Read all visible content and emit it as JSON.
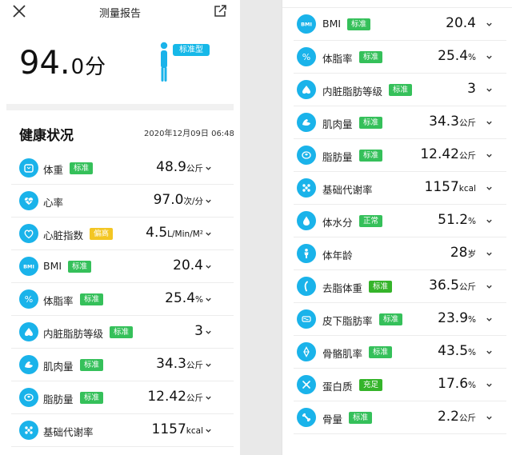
{
  "header": {
    "title": "测量报告"
  },
  "score": {
    "value": "94.",
    "value_small": "0",
    "unit": "分"
  },
  "body_type": {
    "label": "标准型"
  },
  "health": {
    "title": "健康状况",
    "datetime": "2020年12月09日 06:48"
  },
  "colors": {
    "accent": "#1ab3ea",
    "badge_standard": "#35c05a",
    "badge_high": "#f3c623",
    "badge_sufficient": "#35b42a"
  },
  "left_metrics": [
    {
      "name": "体重",
      "badge": "标准",
      "badge_color": "#35c05a",
      "value": "48.9",
      "unit": "公斤",
      "icon": "scale-icon"
    },
    {
      "name": "心率",
      "badge": "",
      "badge_color": "",
      "value": "97.0",
      "unit": "次/分",
      "icon": "heart-rate-icon"
    },
    {
      "name": "心脏指数",
      "badge": "偏高",
      "badge_color": "#f3c623",
      "value": "4.5",
      "unit": "L/Min/M²",
      "icon": "heart-icon"
    },
    {
      "name": "BMI",
      "badge": "标准",
      "badge_color": "#35c05a",
      "value": "20.4",
      "unit": "",
      "icon": "bmi-icon"
    },
    {
      "name": "体脂率",
      "badge": "标准",
      "badge_color": "#35c05a",
      "value": "25.4",
      "unit": "%",
      "icon": "percent-icon"
    },
    {
      "name": "内脏脂肪等级",
      "badge": "标准",
      "badge_color": "#35c05a",
      "value": "3",
      "unit": "",
      "icon": "visceral-fat-icon"
    },
    {
      "name": "肌肉量",
      "badge": "标准",
      "badge_color": "#35c05a",
      "value": "34.3",
      "unit": "公斤",
      "icon": "muscle-icon"
    },
    {
      "name": "脂肪量",
      "badge": "标准",
      "badge_color": "#35c05a",
      "value": "12.42",
      "unit": "公斤",
      "icon": "fat-mass-icon"
    },
    {
      "name": "基础代谢率",
      "badge": "",
      "badge_color": "",
      "value": "1157",
      "unit": "kcal",
      "icon": "metabolism-icon"
    }
  ],
  "right_metrics": [
    {
      "name": "BMI",
      "badge": "标准",
      "badge_color": "#35c05a",
      "value": "20.4",
      "unit": "",
      "icon": "bmi-icon"
    },
    {
      "name": "体脂率",
      "badge": "标准",
      "badge_color": "#35c05a",
      "value": "25.4",
      "unit": "%",
      "icon": "percent-icon"
    },
    {
      "name": "内脏脂肪等级",
      "badge": "标准",
      "badge_color": "#35c05a",
      "value": "3",
      "unit": "",
      "icon": "visceral-fat-icon"
    },
    {
      "name": "肌肉量",
      "badge": "标准",
      "badge_color": "#35c05a",
      "value": "34.3",
      "unit": "公斤",
      "icon": "muscle-icon"
    },
    {
      "name": "脂肪量",
      "badge": "标准",
      "badge_color": "#35c05a",
      "value": "12.42",
      "unit": "公斤",
      "icon": "fat-mass-icon"
    },
    {
      "name": "基础代谢率",
      "badge": "",
      "badge_color": "",
      "value": "1157",
      "unit": "kcal",
      "icon": "metabolism-icon"
    },
    {
      "name": "体水分",
      "badge": "正常",
      "badge_color": "#35c05a",
      "value": "51.2",
      "unit": "%",
      "icon": "water-drop-icon"
    },
    {
      "name": "体年龄",
      "badge": "",
      "badge_color": "",
      "value": "28",
      "unit": "岁",
      "icon": "body-age-icon"
    },
    {
      "name": "去脂体重",
      "badge": "标准",
      "badge_color": "#35b42a",
      "value": "36.5",
      "unit": "公斤",
      "icon": "lean-mass-icon"
    },
    {
      "name": "皮下脂肪率",
      "badge": "标准",
      "badge_color": "#35c05a",
      "value": "23.9",
      "unit": "%",
      "icon": "subcutaneous-fat-icon"
    },
    {
      "name": "骨骼肌率",
      "badge": "标准",
      "badge_color": "#35c05a",
      "value": "43.5",
      "unit": "%",
      "icon": "skeletal-muscle-icon"
    },
    {
      "name": "蛋白质",
      "badge": "充足",
      "badge_color": "#35b42a",
      "value": "17.6",
      "unit": "%",
      "icon": "protein-icon"
    },
    {
      "name": "骨量",
      "badge": "标准",
      "badge_color": "#35c05a",
      "value": "2.2",
      "unit": "公斤",
      "icon": "bone-icon"
    }
  ]
}
